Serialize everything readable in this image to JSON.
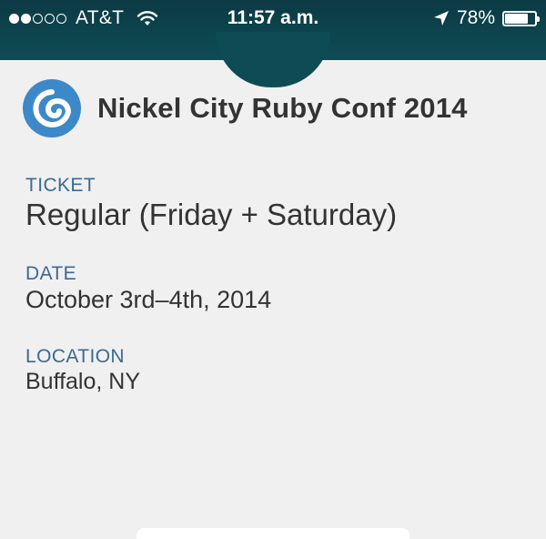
{
  "status_bar": {
    "signal_bars_filled": 2,
    "signal_bars_total": 5,
    "carrier": "AT&T",
    "time": "11:57 a.m.",
    "battery_percent": "78%",
    "battery_level": 0.78
  },
  "event": {
    "title": "Nickel City Ruby Conf 2014",
    "logo_color": "#3d88c8"
  },
  "fields": {
    "ticket": {
      "label": "TICKET",
      "value": "Regular (Friday + Saturday)"
    },
    "date": {
      "label": "DATE",
      "value": "October 3rd–4th, 2014"
    },
    "location": {
      "label": "LOCATION",
      "value": "Buffalo, NY"
    }
  },
  "colors": {
    "header_bg": "#0e4c55",
    "label": "#3a6a92",
    "text": "#333333",
    "background": "#f0f0f0"
  }
}
